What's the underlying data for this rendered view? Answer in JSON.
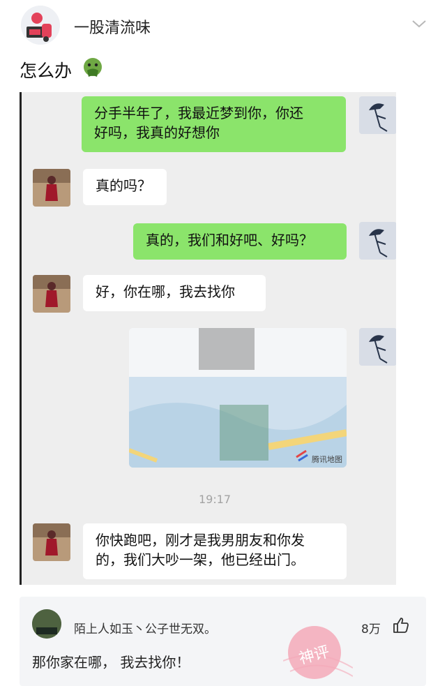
{
  "post": {
    "author": "一股清流味",
    "caption": "怎么办"
  },
  "chat": {
    "messages": [
      {
        "side": "right",
        "text_lines": [
          "分手半年了，我最近梦到你，你还",
          "好吗，我真的好想你"
        ]
      },
      {
        "side": "left",
        "text": "真的吗？"
      },
      {
        "side": "right",
        "text": "真的，我们和好吧、好吗？"
      },
      {
        "side": "left",
        "text": "好，你在哪，我去找你"
      },
      {
        "side": "right",
        "type": "map",
        "map_label": "腾讯地图"
      },
      {
        "type": "time",
        "text": "19:17"
      },
      {
        "side": "left",
        "text_lines": [
          "你快跑吧，刚才是我男朋友和你发",
          "的，我们大吵一架，他已经出门。"
        ]
      }
    ]
  },
  "comment": {
    "user": "陌上人如玉丶公子世无双。",
    "likes": "8万",
    "text": "那你家在哪，  我去找你！",
    "stamp": "神评"
  },
  "icons": [
    "chevron-down-icon",
    "vomit-face-emoji",
    "like-thumb-icon"
  ],
  "colors": {
    "sent_bubble": "#8be46b",
    "received_bubble": "#ffffff",
    "chat_bg": "#eeeeee",
    "stamp": "#f3a9b8"
  }
}
